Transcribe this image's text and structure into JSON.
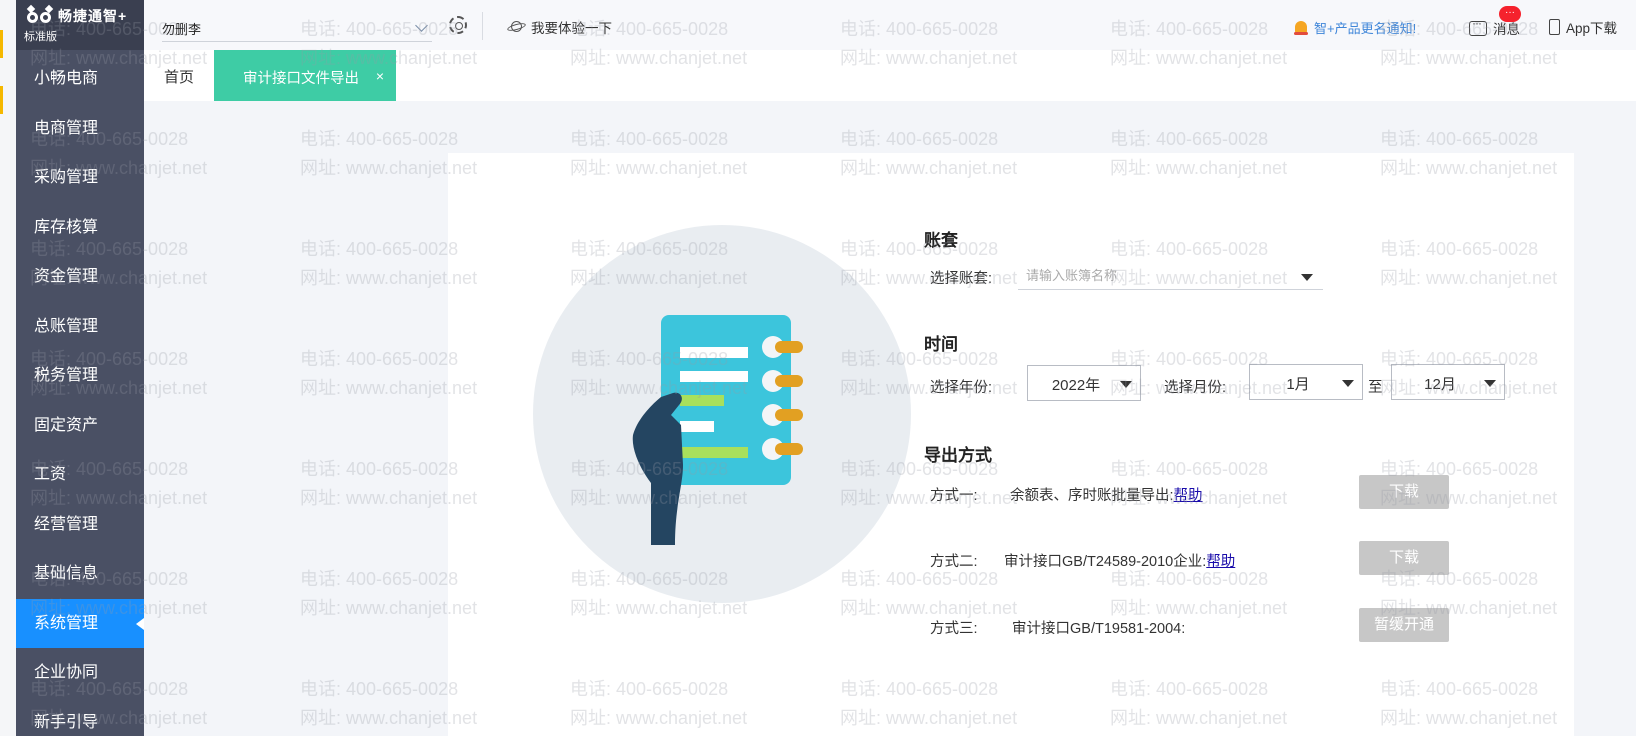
{
  "app": {
    "logo_name": "畅捷通智+",
    "edition": "标准版"
  },
  "sidebar": {
    "items": [
      {
        "label": "小畅电商",
        "active": false
      },
      {
        "label": "电商管理",
        "active": false
      },
      {
        "label": "采购管理",
        "active": false
      },
      {
        "label": "库存核算",
        "active": false
      },
      {
        "label": "资金管理",
        "active": false
      },
      {
        "label": "总账管理",
        "active": false
      },
      {
        "label": "税务管理",
        "active": false
      },
      {
        "label": "固定资产",
        "active": false
      },
      {
        "label": "工资",
        "active": false
      },
      {
        "label": "经营管理",
        "active": false
      },
      {
        "label": "基础信息",
        "active": false
      },
      {
        "label": "系统管理",
        "active": true
      },
      {
        "label": "企业协同",
        "active": false
      },
      {
        "label": "新手引导",
        "active": false
      }
    ]
  },
  "topbar": {
    "account_name": "勿删李",
    "try_label": "我要体验一下",
    "notice": "智+产品更名通知!",
    "messages_label": "消息",
    "messages_badge": "···",
    "app_download": "App下载"
  },
  "tabs": {
    "home": "首页",
    "active": "审计接口文件导出",
    "close": "×"
  },
  "form": {
    "account_section": "账套",
    "account_label": "选择账套:",
    "account_placeholder": "请输入账簿名称",
    "time_section": "时间",
    "year_label": "选择年份:",
    "year_value": "2022年",
    "month_label": "选择月份:",
    "month_from": "1月",
    "to_label": "至",
    "month_to": "12月",
    "export_section": "导出方式",
    "methods": [
      {
        "label": "方式一:",
        "desc": "余额表、序时账批量导出:",
        "help": "帮助",
        "button": "下载"
      },
      {
        "label": "方式二:",
        "desc": "审计接口GB/T24589-2010企业:",
        "help": "帮助",
        "button": "下载"
      },
      {
        "label": "方式三:",
        "desc": "审计接口GB/T19581-2004:",
        "help": "",
        "button": "暂缓开通"
      }
    ]
  },
  "watermark": {
    "phone": "电话: 400-665-0028",
    "site": "网址: www.chanjet.net"
  },
  "colors": {
    "sidebar_bg": "#4a5064",
    "sidebar_active": "#1890ff",
    "tab_active": "#3ecca5",
    "button_disabled": "#c7c7c7",
    "link": "#1a0dab"
  }
}
